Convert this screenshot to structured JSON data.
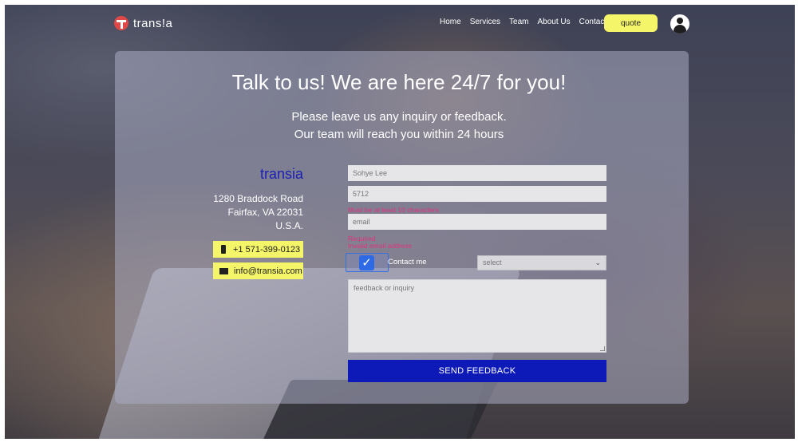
{
  "nav": {
    "logo_text": "trans!a",
    "links": [
      "Home",
      "Services",
      "Team",
      "About Us",
      "Contact"
    ],
    "quote_label": "quote",
    "user_icon": "user-circle-icon"
  },
  "hero": {
    "headline": "Talk to us! We are here 24/7 for you!",
    "sub_line1": "Please leave us any inquiry or feedback.",
    "sub_line2": "Our team will reach you within 24 hours"
  },
  "company": {
    "name": "transia",
    "address_line1": "1280 Braddock Road",
    "address_line2": "Fairfax, VA 22031",
    "address_line3": "U.S.A.",
    "phone": "+1 571-399-0123",
    "email": "info@transia.com",
    "phone_icon": "phone-icon",
    "mail_icon": "mail-icon"
  },
  "form": {
    "name_value": "Sohye Lee",
    "number_value": "5712",
    "number_error": "Must be at least 10 characters",
    "email_placeholder": "email",
    "email_error_required": "Required",
    "email_error_invalid": "Invalid email address",
    "contact_me_label": "Contact me",
    "contact_me_checked": true,
    "select_value": "select",
    "feedback_placeholder": "feedback or inquiry",
    "send_label": "SEND FEEDBACK"
  },
  "colors": {
    "accent_yellow": "#f5f56a",
    "brand_blue": "#0d1ab7",
    "error_pink": "#e0337d",
    "logo_red": "#e04848"
  }
}
